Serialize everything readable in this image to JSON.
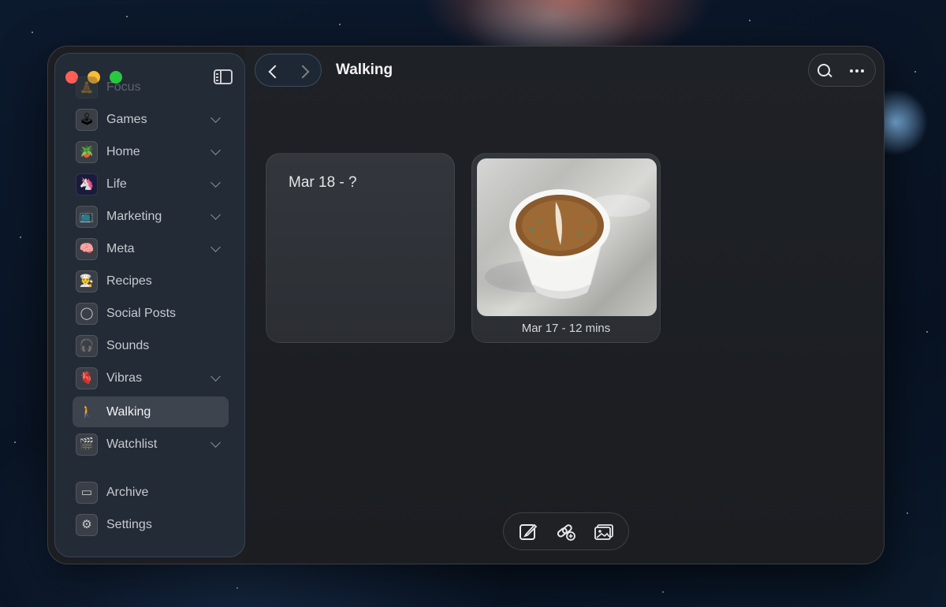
{
  "sidebar": {
    "items": [
      {
        "label": "Focus",
        "icon": "meditation-emoji-icon",
        "glyph": "🧘",
        "chevron": false,
        "active": false
      },
      {
        "label": "Games",
        "icon": "joystick-emoji-icon",
        "glyph": "🕹",
        "chevron": true,
        "active": false
      },
      {
        "label": "Home",
        "icon": "potted-plant-emoji-icon",
        "glyph": "🪴",
        "chevron": true,
        "active": false
      },
      {
        "label": "Life",
        "icon": "unicorn-emoji-icon",
        "glyph": "🦄",
        "chevron": true,
        "active": false
      },
      {
        "label": "Marketing",
        "icon": "television-emoji-icon",
        "glyph": "📺",
        "chevron": true,
        "active": false
      },
      {
        "label": "Meta",
        "icon": "brain-emoji-icon",
        "glyph": "🧠",
        "chevron": true,
        "active": false
      },
      {
        "label": "Recipes",
        "icon": "chef-emoji-icon",
        "glyph": "👨‍🍳",
        "chevron": false,
        "active": false
      },
      {
        "label": "Social Posts",
        "icon": "circle-icon",
        "glyph": "◯",
        "chevron": false,
        "active": false
      },
      {
        "label": "Sounds",
        "icon": "headphones-icon",
        "glyph": "🎧",
        "chevron": false,
        "active": false
      },
      {
        "label": "Vibras",
        "icon": "heart-emoji-icon",
        "glyph": "🫀",
        "chevron": true,
        "active": false
      },
      {
        "label": "Walking",
        "icon": "walking-person-emoji-icon",
        "glyph": "🚶",
        "chevron": false,
        "active": true
      },
      {
        "label": "Watchlist",
        "icon": "clapperboard-emoji-icon",
        "glyph": "🎬",
        "chevron": true,
        "active": false
      }
    ],
    "footer": [
      {
        "label": "Archive",
        "icon": "archive-box-icon",
        "glyph": "▭"
      },
      {
        "label": "Settings",
        "icon": "gear-icon",
        "glyph": "⚙"
      }
    ]
  },
  "header": {
    "title": "Walking"
  },
  "cards": [
    {
      "title": "Mar 18 - ?",
      "has_image": false
    },
    {
      "caption": "Mar 17 - 12 mins",
      "has_image": true,
      "image_subject": "coffee-cup-photo"
    }
  ],
  "toolbar": {
    "buttons": [
      "compose-note-icon",
      "add-link-icon",
      "add-photo-icon"
    ]
  },
  "colors": {
    "window_bg": "#1c1e22",
    "sidebar_bg": "#242c38",
    "card_bg": "#303339",
    "close": "#ff5f57",
    "minimize": "#febc2e",
    "maximize": "#28c840"
  }
}
